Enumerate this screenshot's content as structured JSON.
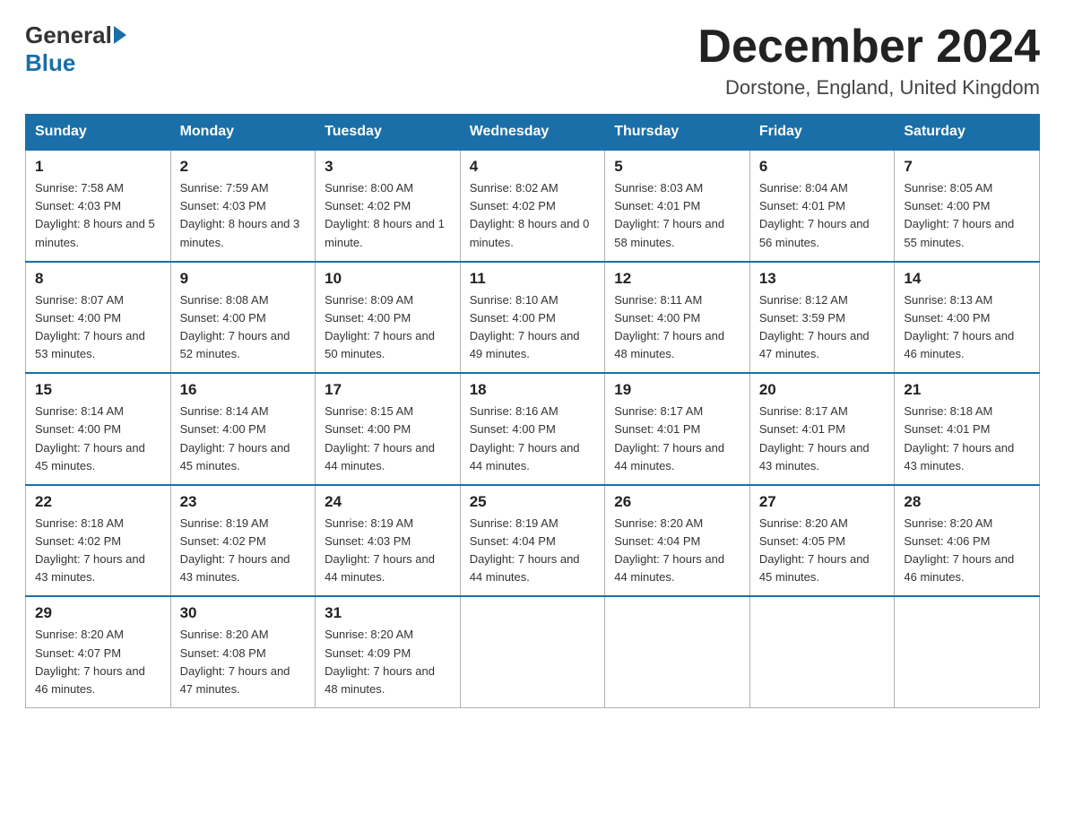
{
  "header": {
    "logo_general": "General",
    "logo_blue": "Blue",
    "month_title": "December 2024",
    "location": "Dorstone, England, United Kingdom"
  },
  "days_of_week": [
    "Sunday",
    "Monday",
    "Tuesday",
    "Wednesday",
    "Thursday",
    "Friday",
    "Saturday"
  ],
  "weeks": [
    [
      {
        "day": "1",
        "sunrise": "7:58 AM",
        "sunset": "4:03 PM",
        "daylight": "8 hours and 5 minutes."
      },
      {
        "day": "2",
        "sunrise": "7:59 AM",
        "sunset": "4:03 PM",
        "daylight": "8 hours and 3 minutes."
      },
      {
        "day": "3",
        "sunrise": "8:00 AM",
        "sunset": "4:02 PM",
        "daylight": "8 hours and 1 minute."
      },
      {
        "day": "4",
        "sunrise": "8:02 AM",
        "sunset": "4:02 PM",
        "daylight": "8 hours and 0 minutes."
      },
      {
        "day": "5",
        "sunrise": "8:03 AM",
        "sunset": "4:01 PM",
        "daylight": "7 hours and 58 minutes."
      },
      {
        "day": "6",
        "sunrise": "8:04 AM",
        "sunset": "4:01 PM",
        "daylight": "7 hours and 56 minutes."
      },
      {
        "day": "7",
        "sunrise": "8:05 AM",
        "sunset": "4:00 PM",
        "daylight": "7 hours and 55 minutes."
      }
    ],
    [
      {
        "day": "8",
        "sunrise": "8:07 AM",
        "sunset": "4:00 PM",
        "daylight": "7 hours and 53 minutes."
      },
      {
        "day": "9",
        "sunrise": "8:08 AM",
        "sunset": "4:00 PM",
        "daylight": "7 hours and 52 minutes."
      },
      {
        "day": "10",
        "sunrise": "8:09 AM",
        "sunset": "4:00 PM",
        "daylight": "7 hours and 50 minutes."
      },
      {
        "day": "11",
        "sunrise": "8:10 AM",
        "sunset": "4:00 PM",
        "daylight": "7 hours and 49 minutes."
      },
      {
        "day": "12",
        "sunrise": "8:11 AM",
        "sunset": "4:00 PM",
        "daylight": "7 hours and 48 minutes."
      },
      {
        "day": "13",
        "sunrise": "8:12 AM",
        "sunset": "3:59 PM",
        "daylight": "7 hours and 47 minutes."
      },
      {
        "day": "14",
        "sunrise": "8:13 AM",
        "sunset": "4:00 PM",
        "daylight": "7 hours and 46 minutes."
      }
    ],
    [
      {
        "day": "15",
        "sunrise": "8:14 AM",
        "sunset": "4:00 PM",
        "daylight": "7 hours and 45 minutes."
      },
      {
        "day": "16",
        "sunrise": "8:14 AM",
        "sunset": "4:00 PM",
        "daylight": "7 hours and 45 minutes."
      },
      {
        "day": "17",
        "sunrise": "8:15 AM",
        "sunset": "4:00 PM",
        "daylight": "7 hours and 44 minutes."
      },
      {
        "day": "18",
        "sunrise": "8:16 AM",
        "sunset": "4:00 PM",
        "daylight": "7 hours and 44 minutes."
      },
      {
        "day": "19",
        "sunrise": "8:17 AM",
        "sunset": "4:01 PM",
        "daylight": "7 hours and 44 minutes."
      },
      {
        "day": "20",
        "sunrise": "8:17 AM",
        "sunset": "4:01 PM",
        "daylight": "7 hours and 43 minutes."
      },
      {
        "day": "21",
        "sunrise": "8:18 AM",
        "sunset": "4:01 PM",
        "daylight": "7 hours and 43 minutes."
      }
    ],
    [
      {
        "day": "22",
        "sunrise": "8:18 AM",
        "sunset": "4:02 PM",
        "daylight": "7 hours and 43 minutes."
      },
      {
        "day": "23",
        "sunrise": "8:19 AM",
        "sunset": "4:02 PM",
        "daylight": "7 hours and 43 minutes."
      },
      {
        "day": "24",
        "sunrise": "8:19 AM",
        "sunset": "4:03 PM",
        "daylight": "7 hours and 44 minutes."
      },
      {
        "day": "25",
        "sunrise": "8:19 AM",
        "sunset": "4:04 PM",
        "daylight": "7 hours and 44 minutes."
      },
      {
        "day": "26",
        "sunrise": "8:20 AM",
        "sunset": "4:04 PM",
        "daylight": "7 hours and 44 minutes."
      },
      {
        "day": "27",
        "sunrise": "8:20 AM",
        "sunset": "4:05 PM",
        "daylight": "7 hours and 45 minutes."
      },
      {
        "day": "28",
        "sunrise": "8:20 AM",
        "sunset": "4:06 PM",
        "daylight": "7 hours and 46 minutes."
      }
    ],
    [
      {
        "day": "29",
        "sunrise": "8:20 AM",
        "sunset": "4:07 PM",
        "daylight": "7 hours and 46 minutes."
      },
      {
        "day": "30",
        "sunrise": "8:20 AM",
        "sunset": "4:08 PM",
        "daylight": "7 hours and 47 minutes."
      },
      {
        "day": "31",
        "sunrise": "8:20 AM",
        "sunset": "4:09 PM",
        "daylight": "7 hours and 48 minutes."
      },
      null,
      null,
      null,
      null
    ]
  ]
}
